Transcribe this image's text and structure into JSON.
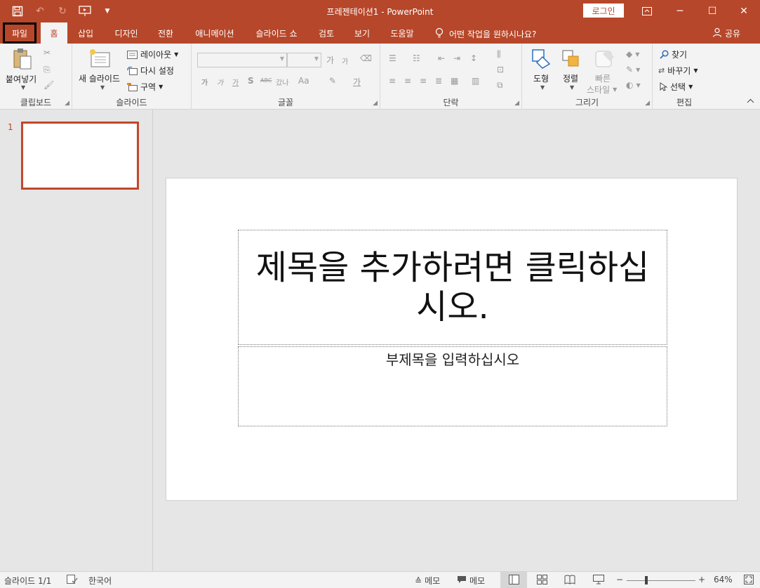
{
  "window": {
    "title": "프레젠테이션1  -  PowerPoint",
    "login_label": "로그인",
    "qat": [
      "save-icon",
      "undo-icon",
      "redo-icon",
      "present-from-start-icon",
      "customize-qat-icon"
    ],
    "controls": [
      "ribbon-display-icon",
      "minimize-icon",
      "maximize-icon",
      "close-icon"
    ]
  },
  "tabs": {
    "file": "파일",
    "home": "홈",
    "insert": "삽입",
    "design": "디자인",
    "transitions": "전환",
    "animations": "애니메이션",
    "slideshow": "슬라이드 쇼",
    "review": "검토",
    "view": "보기",
    "help": "도움말",
    "tell_me": "어떤 작업을 원하시나요?",
    "share": "공유"
  },
  "ribbon": {
    "clipboard": {
      "label": "클립보드",
      "paste": "붙여넣기"
    },
    "slides": {
      "label": "슬라이드",
      "new_slide": "새 슬라이드",
      "layout": "레이아웃",
      "reset": "다시 설정",
      "section": "구역"
    },
    "font": {
      "label": "글꼴",
      "grow": "가",
      "shrink": "가",
      "bold": "가",
      "italic": "가",
      "underline": "가",
      "shadow": "S",
      "strike": "ABC",
      "spacing": "갔나",
      "case": "Aa",
      "color": "가"
    },
    "paragraph": {
      "label": "단락"
    },
    "drawing": {
      "label": "그리기",
      "shapes": "도형",
      "arrange": "정렬",
      "quick_styles_1": "빠른",
      "quick_styles_2": "스타일"
    },
    "editing": {
      "label": "편집",
      "find": "찾기",
      "replace": "바꾸기",
      "select": "선택"
    }
  },
  "thumbnails": {
    "slide_number": "1"
  },
  "slide": {
    "title_placeholder": "제목을 추가하려면 클릭하십시오.",
    "subtitle_placeholder": "부제목을 입력하십시오"
  },
  "status": {
    "slide_counter": "슬라이드 1/1",
    "language": "한국어",
    "notes": "메모",
    "comments": "메모",
    "zoom_minus": "−",
    "zoom_plus": "+",
    "zoom": "64%",
    "zoom_fraction": 0.64
  },
  "colors": {
    "accent": "#b7472a",
    "ribbon_bg": "#f3f3f3",
    "workspace_bg": "#e6e6e6"
  }
}
